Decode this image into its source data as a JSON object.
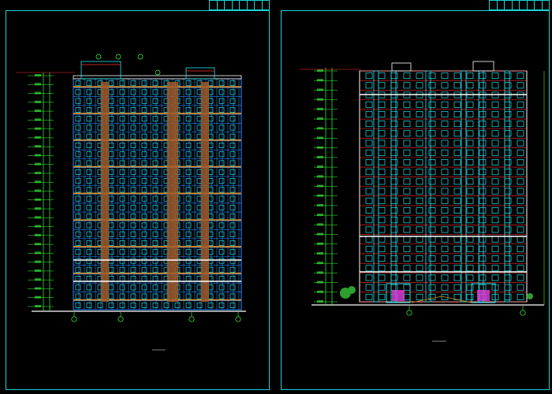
{
  "drawing": {
    "background_color": "#000000",
    "frame_color": "#17d4d4",
    "line_colors": {
      "facade_blue": "#2a8cff",
      "window_cyan": "#23e6f2",
      "band_orange": "#d98a1e",
      "shaft_brown": "#a05a2a",
      "dimension_green": "#3cff3c",
      "slab_white": "#ffffff",
      "roof_red": "#ff3030",
      "entrance_magenta": "#e040e0",
      "tree_green": "#2e9e2e"
    }
  },
  "sheets": [
    {
      "id": "left",
      "title_block_cells": [
        "",
        "",
        "",
        "",
        "",
        "",
        "",
        ""
      ],
      "caption": "",
      "axis_bubbles": [
        "",
        "",
        "",
        ""
      ],
      "levels": 26
    },
    {
      "id": "right",
      "title_block_cells": [
        "",
        "",
        "",
        "",
        "",
        "",
        "",
        ""
      ],
      "caption": "",
      "note": "",
      "axis_bubbles": [
        "",
        ""
      ],
      "levels": 24
    }
  ]
}
